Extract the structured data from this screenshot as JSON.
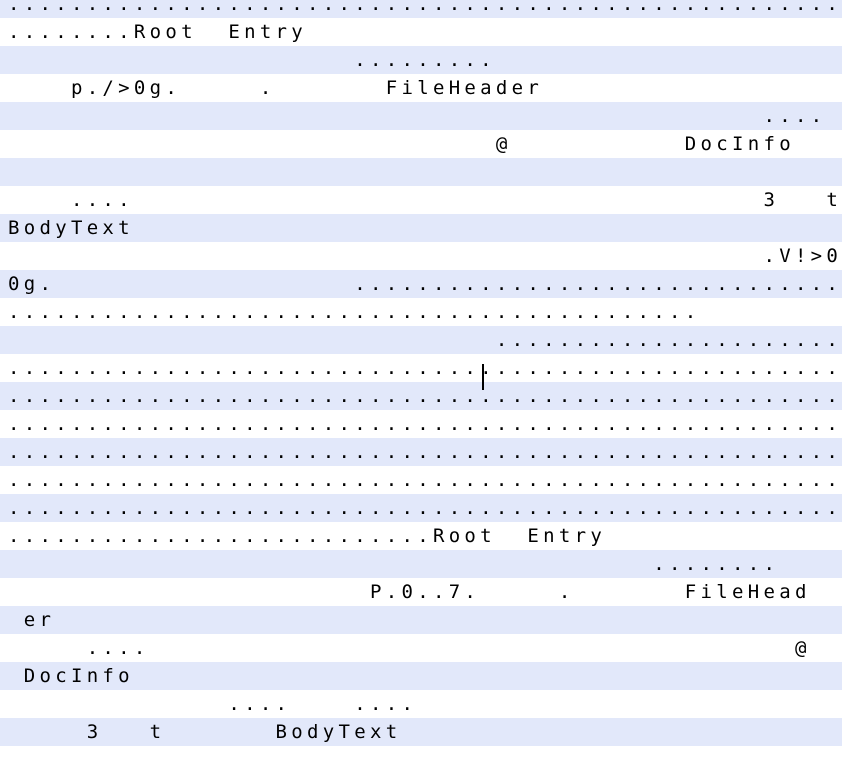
{
  "editor": {
    "lines": [
      "..............................................................",
      "........Root  Entry",
      "                      .........",
      "    p./>0g.     .       FileHeader",
      "                                                ....",
      "                               @           DocInfo",
      "                                                         ....",
      "    ....                                        3   t",
      "BodyText",
      "                                                .V!>0g. .V!>",
      "0g.                   ................................",
      "............................................",
      "                               .........................",
      "..............................................................",
      "..............................................................",
      "..............................................................",
      "..............................................................",
      "..............................................................",
      "..............................................................",
      "...........................Root  Entry",
      "                                         ........",
      "                       P.0..7.     .       FileHead",
      " er",
      "     ....                                         @",
      " DocInfo",
      "              ....    ....",
      "     3   t       BodyText",
      ""
    ]
  }
}
